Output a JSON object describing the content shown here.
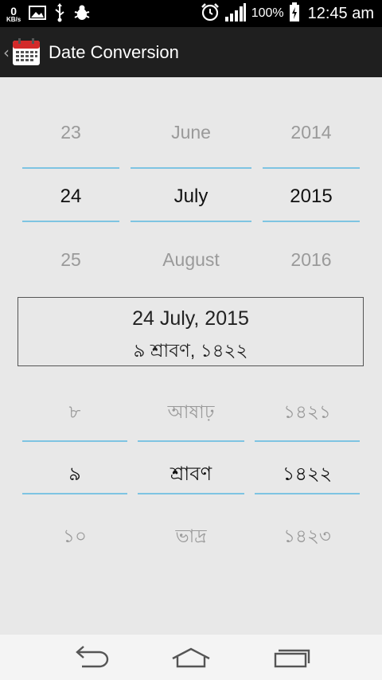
{
  "status_bar": {
    "net_speed_value": "0",
    "net_speed_unit": "KB/s",
    "battery_percent": "100%",
    "time": "12:45 am",
    "icons": [
      "image-icon",
      "usb-icon",
      "debug-bug-icon",
      "alarm-icon",
      "signal-icon",
      "battery-icon"
    ]
  },
  "action_bar": {
    "title": "Date Conversion",
    "icon": "calendar-icon"
  },
  "gregorian_picker": {
    "day": {
      "prev": "23",
      "selected": "24",
      "next": "25"
    },
    "month": {
      "prev": "June",
      "selected": "July",
      "next": "August"
    },
    "year": {
      "prev": "2014",
      "selected": "2015",
      "next": "2016"
    }
  },
  "result": {
    "english": "24 July, 2015",
    "bengali": "৯ শ্রাবণ, ১৪২২"
  },
  "bengali_picker": {
    "day": {
      "prev": "৮",
      "selected": "৯",
      "next": "১০"
    },
    "month": {
      "prev": "আষাঢ়",
      "selected": "শ্রাবণ",
      "next": "ভাদ্র"
    },
    "year": {
      "prev": "১৪২১",
      "selected": "১৪২২",
      "next": "১৪২৩"
    }
  },
  "nav_bar": {
    "icons": [
      "back-icon",
      "home-icon",
      "recent-apps-icon"
    ]
  },
  "colors": {
    "accent_line": "#7ec4e2",
    "background": "#e8e8e8",
    "action_bar": "#1f1f1f"
  }
}
